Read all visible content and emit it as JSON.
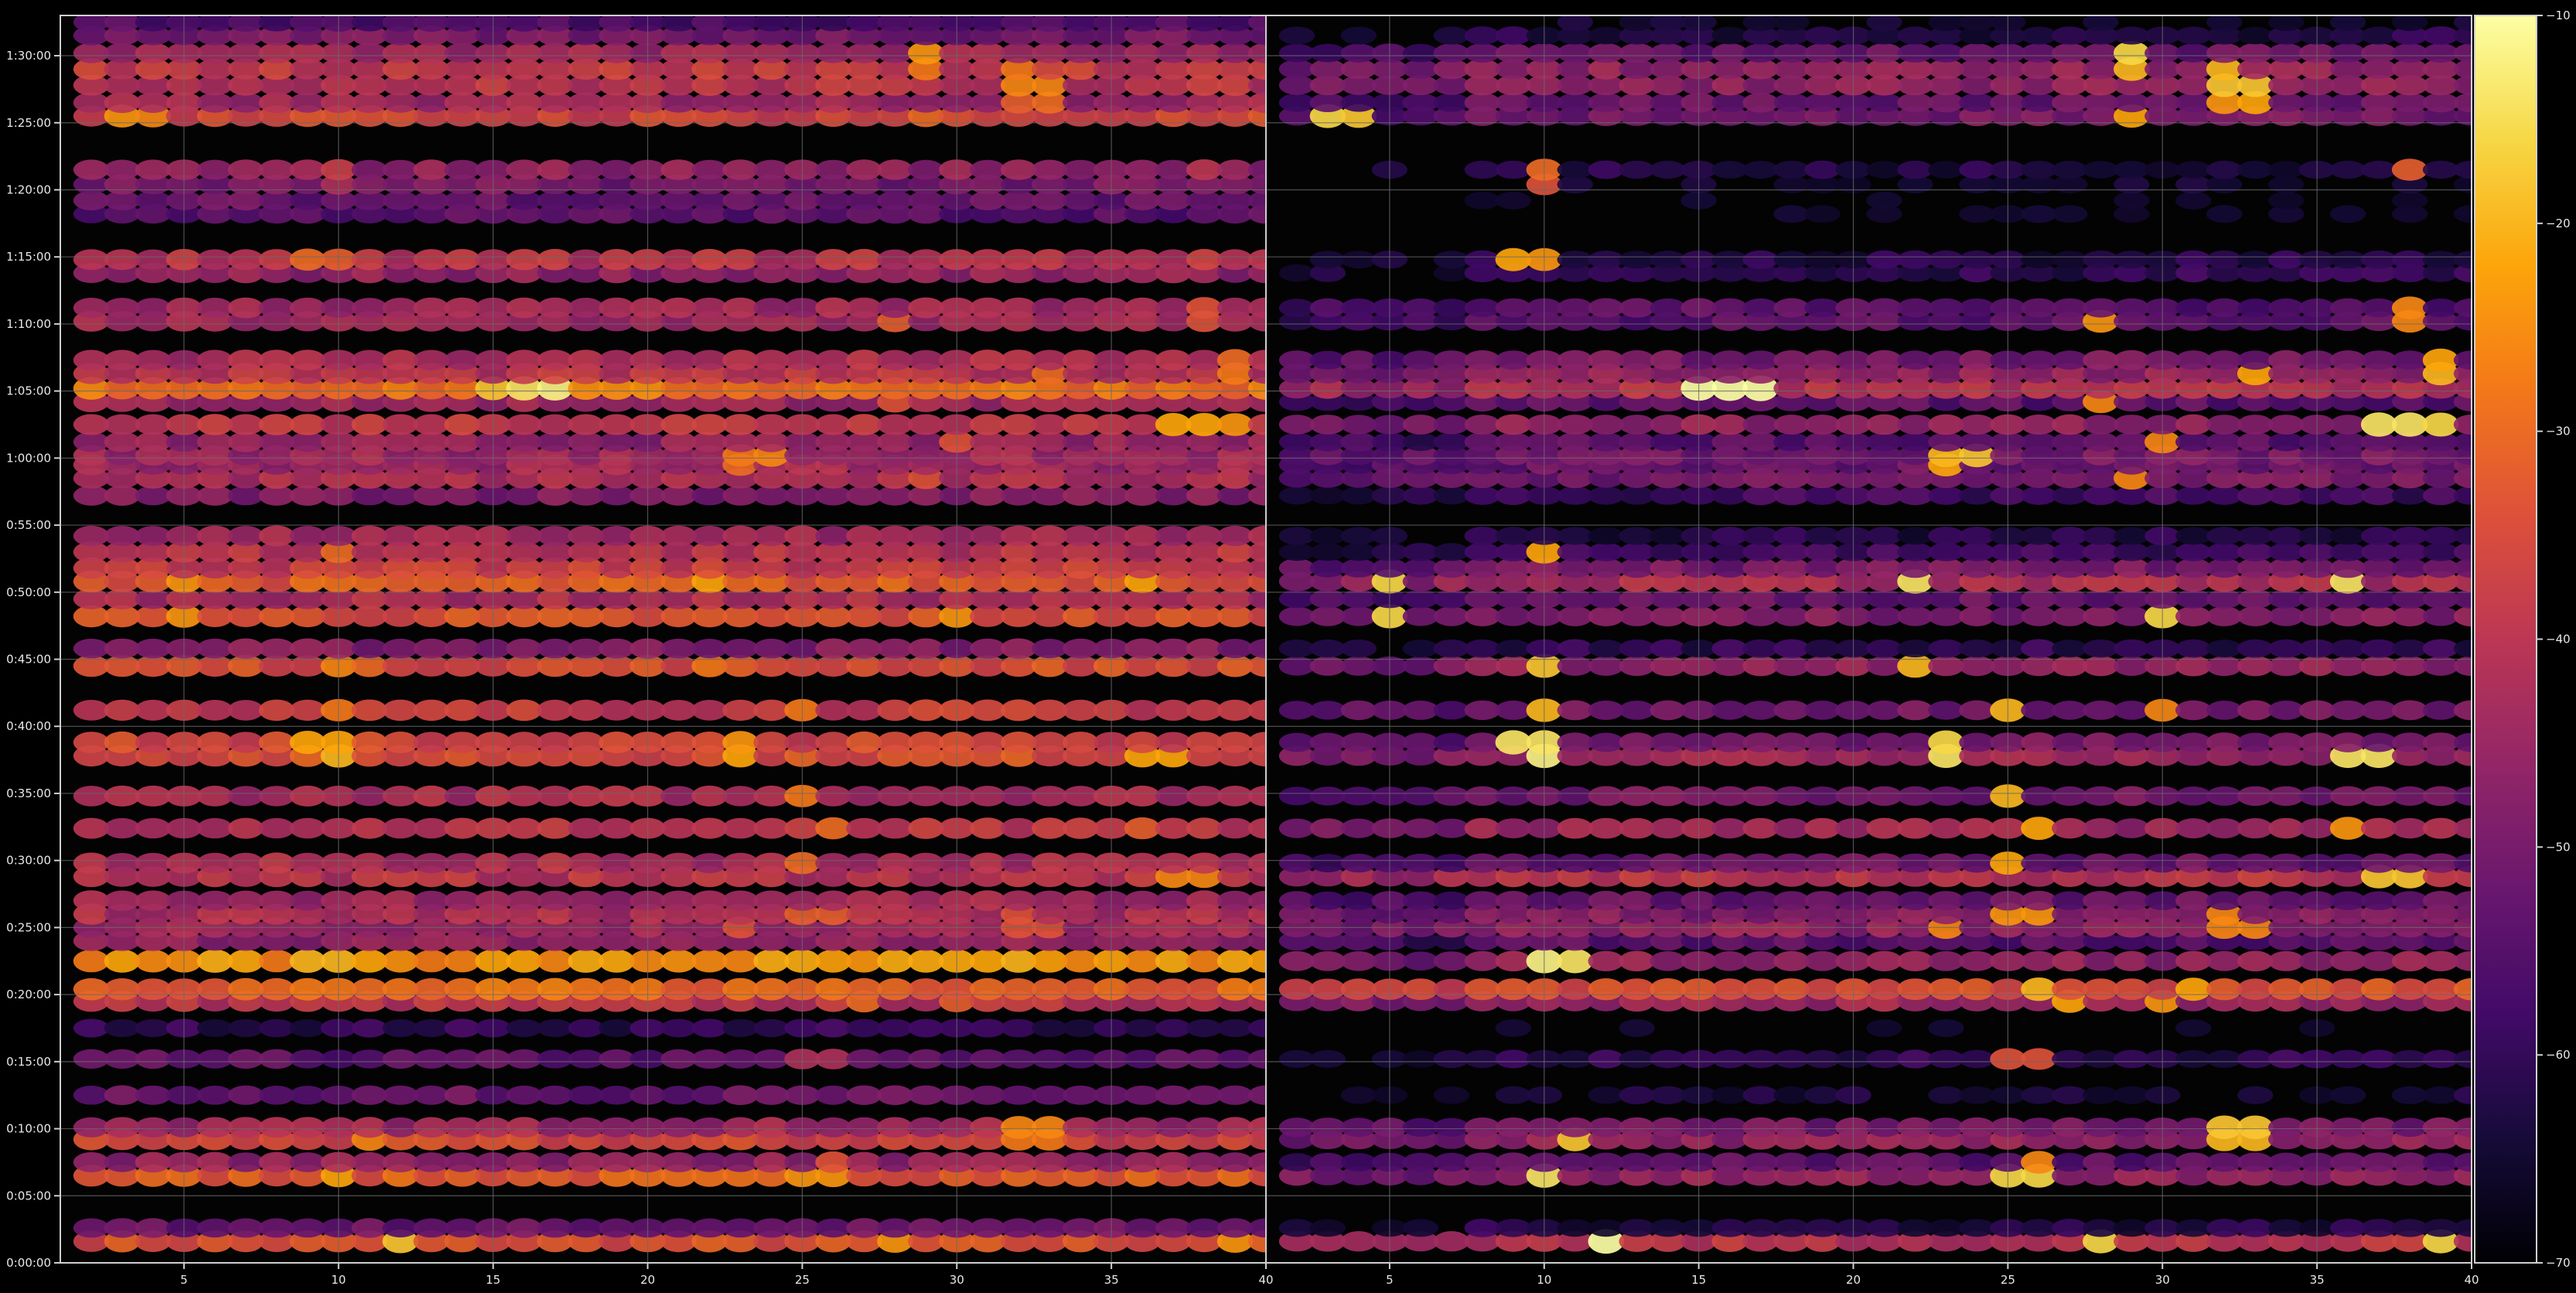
{
  "chart_data": {
    "type": "heatmap",
    "title": "",
    "xlabel": "",
    "ylabel": "",
    "panels": [
      {
        "name": "left",
        "xlim": [
          1,
          40
        ],
        "xticks": [
          5,
          10,
          15,
          20,
          25,
          30,
          35,
          40
        ],
        "x_columns": [
          2,
          40
        ]
      },
      {
        "name": "right",
        "xlim": [
          1,
          40
        ],
        "xticks": [
          5,
          10,
          15,
          20,
          25,
          30,
          35,
          40
        ],
        "x_columns": [
          2,
          40
        ]
      }
    ],
    "y_axis": {
      "unit": "minutes",
      "range_minutes": [
        0,
        93
      ],
      "ticks_minutes": [
        0,
        5,
        10,
        15,
        20,
        25,
        30,
        35,
        40,
        45,
        50,
        55,
        60,
        65,
        70,
        75,
        80,
        85,
        90
      ],
      "tick_labels": [
        "0:00:00",
        "0:05:00",
        "0:10:00",
        "0:15:00",
        "0:20:00",
        "0:25:00",
        "0:30:00",
        "0:35:00",
        "0:40:00",
        "0:45:00",
        "0:50:00",
        "0:55:00",
        "1:00:00",
        "1:05:00",
        "1:10:00",
        "1:15:00",
        "1:20:00",
        "1:25:00",
        "1:30:00"
      ]
    },
    "colorbar": {
      "colormap": "inferno",
      "range": [
        -70,
        -10
      ],
      "ticks": [
        -70,
        -60,
        -50,
        -40,
        -30,
        -20,
        -10
      ],
      "tick_labels": [
        "−70",
        "−60",
        "−50",
        "−40",
        "−30",
        "−20",
        "−10"
      ]
    },
    "grid": true,
    "background": "#000000",
    "bands": [
      {
        "t": 1.6,
        "left": -34,
        "right": -40,
        "peaks": [
          [
            12,
            -18
          ],
          [
            28,
            -24
          ],
          [
            39,
            -24
          ]
        ]
      },
      {
        "t": 2.6,
        "left": -52,
        "right": -62,
        "peaks": []
      },
      {
        "t": 6.5,
        "left": -32,
        "right": -46,
        "peaks": [
          [
            10,
            -22
          ],
          [
            25,
            -24
          ],
          [
            26,
            -24
          ]
        ]
      },
      {
        "t": 7.5,
        "left": -46,
        "right": -54,
        "peaks": [
          [
            26,
            -34
          ]
        ]
      },
      {
        "t": 9.2,
        "left": -36,
        "right": -46,
        "peaks": [
          [
            11,
            -26
          ],
          [
            32,
            -28
          ],
          [
            33,
            -28
          ]
        ]
      },
      {
        "t": 10.1,
        "left": -44,
        "right": -50,
        "peaks": [
          [
            32,
            -26
          ],
          [
            33,
            -26
          ]
        ]
      },
      {
        "t": 12.5,
        "left": -52,
        "right": -64,
        "peaks": []
      },
      {
        "t": 15.2,
        "left": -54,
        "right": -60,
        "peaks": [
          [
            25,
            -42
          ],
          [
            26,
            -42
          ]
        ]
      },
      {
        "t": 17.5,
        "left": -60,
        "right": -68,
        "peaks": []
      },
      {
        "t": 19.5,
        "left": -40,
        "right": -44,
        "peaks": [
          [
            27,
            -30
          ],
          [
            30,
            -32
          ]
        ]
      },
      {
        "t": 20.4,
        "left": -30,
        "right": -34,
        "peaks": [
          [
            26,
            -28
          ],
          [
            31,
            -30
          ]
        ]
      },
      {
        "t": 22.5,
        "left": -24,
        "right": -46,
        "peaks": [
          [
            10,
            -20
          ],
          [
            11,
            -22
          ]
        ]
      },
      {
        "t": 24.0,
        "left": -46,
        "right": -54,
        "peaks": []
      },
      {
        "t": 25.0,
        "left": -44,
        "right": -46,
        "peaks": [
          [
            23,
            -34
          ],
          [
            32,
            -34
          ],
          [
            33,
            -34
          ]
        ]
      },
      {
        "t": 26.0,
        "left": -42,
        "right": -48,
        "peaks": [
          [
            25,
            -32
          ],
          [
            26,
            -32
          ],
          [
            32,
            -34
          ]
        ]
      },
      {
        "t": 27.0,
        "left": -44,
        "right": -52,
        "peaks": []
      },
      {
        "t": 28.8,
        "left": -40,
        "right": -40,
        "peaks": [
          [
            37,
            -26
          ],
          [
            38,
            -26
          ]
        ]
      },
      {
        "t": 29.8,
        "left": -42,
        "right": -52,
        "peaks": [
          [
            25,
            -30
          ]
        ]
      },
      {
        "t": 32.4,
        "left": -40,
        "right": -44,
        "peaks": [
          [
            26,
            -30
          ],
          [
            36,
            -32
          ]
        ]
      },
      {
        "t": 34.8,
        "left": -42,
        "right": -50,
        "peaks": [
          [
            25,
            -28
          ]
        ]
      },
      {
        "t": 37.8,
        "left": -34,
        "right": -44,
        "peaks": [
          [
            10,
            -20
          ],
          [
            23,
            -22
          ],
          [
            36,
            -22
          ],
          [
            37,
            -22
          ]
        ]
      },
      {
        "t": 38.8,
        "left": -36,
        "right": -50,
        "peaks": [
          [
            9,
            -22
          ],
          [
            10,
            -22
          ],
          [
            23,
            -24
          ]
        ]
      },
      {
        "t": 41.2,
        "left": -38,
        "right": -50,
        "peaks": [
          [
            10,
            -28
          ],
          [
            25,
            -28
          ],
          [
            30,
            -34
          ]
        ]
      },
      {
        "t": 44.5,
        "left": -34,
        "right": -46,
        "peaks": [
          [
            10,
            -26
          ],
          [
            22,
            -28
          ]
        ]
      },
      {
        "t": 45.8,
        "left": -48,
        "right": -60,
        "peaks": []
      },
      {
        "t": 48.2,
        "left": -34,
        "right": -48,
        "peaks": [
          [
            5,
            -24
          ],
          [
            30,
            -24
          ]
        ]
      },
      {
        "t": 49.5,
        "left": -42,
        "right": -52,
        "peaks": []
      },
      {
        "t": 50.8,
        "left": -32,
        "right": -42,
        "peaks": [
          [
            5,
            -24
          ],
          [
            22,
            -22
          ],
          [
            36,
            -22
          ]
        ]
      },
      {
        "t": 51.8,
        "left": -38,
        "right": -50,
        "peaks": []
      },
      {
        "t": 53.0,
        "left": -40,
        "right": -58,
        "peaks": [
          [
            10,
            -30
          ]
        ]
      },
      {
        "t": 54.2,
        "left": -44,
        "right": -62,
        "peaks": []
      },
      {
        "t": 57.2,
        "left": -48,
        "right": -58,
        "peaks": []
      },
      {
        "t": 58.5,
        "left": -42,
        "right": -50,
        "peaks": [
          [
            29,
            -34
          ]
        ]
      },
      {
        "t": 59.5,
        "left": -44,
        "right": -52,
        "peaks": [
          [
            23,
            -30
          ]
        ]
      },
      {
        "t": 60.2,
        "left": -44,
        "right": -50,
        "peaks": [
          [
            23,
            -28
          ],
          [
            24,
            -26
          ]
        ]
      },
      {
        "t": 61.2,
        "left": -46,
        "right": -54,
        "peaks": [
          [
            30,
            -34
          ]
        ]
      },
      {
        "t": 62.5,
        "left": -38,
        "right": -46,
        "peaks": [
          [
            37,
            -22
          ],
          [
            38,
            -22
          ],
          [
            39,
            -24
          ]
        ]
      },
      {
        "t": 64.2,
        "left": -44,
        "right": -54,
        "peaks": [
          [
            28,
            -34
          ]
        ]
      },
      {
        "t": 65.2,
        "left": -28,
        "right": -40,
        "peaks": [
          [
            16,
            -14
          ],
          [
            17,
            -12
          ],
          [
            15,
            -18
          ]
        ]
      },
      {
        "t": 66.3,
        "left": -40,
        "right": -46,
        "peaks": [
          [
            33,
            -30
          ],
          [
            39,
            -28
          ]
        ]
      },
      {
        "t": 67.3,
        "left": -42,
        "right": -50,
        "peaks": [
          [
            39,
            -30
          ]
        ]
      },
      {
        "t": 70.2,
        "left": -44,
        "right": -54,
        "peaks": [
          [
            28,
            -32
          ],
          [
            38,
            -34
          ]
        ]
      },
      {
        "t": 71.2,
        "left": -44,
        "right": -54,
        "peaks": [
          [
            38,
            -34
          ]
        ]
      },
      {
        "t": 73.8,
        "left": -46,
        "right": -60,
        "peaks": []
      },
      {
        "t": 74.8,
        "left": -40,
        "right": -62,
        "peaks": [
          [
            9,
            -30
          ],
          [
            10,
            -32
          ]
        ]
      },
      {
        "t": 78.2,
        "left": -54,
        "right": -68,
        "peaks": []
      },
      {
        "t": 79.2,
        "left": -52,
        "right": -68,
        "peaks": []
      },
      {
        "t": 80.4,
        "left": -50,
        "right": -66,
        "peaks": [
          [
            10,
            -42
          ]
        ]
      },
      {
        "t": 81.5,
        "left": -46,
        "right": -62,
        "peaks": [
          [
            10,
            -38
          ],
          [
            38,
            -40
          ]
        ]
      },
      {
        "t": 85.5,
        "left": -36,
        "right": -50,
        "peaks": [
          [
            3,
            -24
          ],
          [
            4,
            -26
          ],
          [
            29,
            -30
          ]
        ]
      },
      {
        "t": 86.5,
        "left": -44,
        "right": -52,
        "peaks": [
          [
            32,
            -32
          ],
          [
            33,
            -30
          ]
        ]
      },
      {
        "t": 87.8,
        "left": -40,
        "right": -46,
        "peaks": [
          [
            32,
            -26
          ],
          [
            33,
            -26
          ]
        ]
      },
      {
        "t": 89.0,
        "left": -38,
        "right": -46,
        "peaks": [
          [
            29,
            -28
          ],
          [
            32,
            -28
          ]
        ]
      },
      {
        "t": 90.2,
        "left": -44,
        "right": -52,
        "peaks": [
          [
            29,
            -24
          ]
        ]
      },
      {
        "t": 91.5,
        "left": -50,
        "right": -62,
        "peaks": []
      },
      {
        "t": 92.5,
        "left": -56,
        "right": -66,
        "peaks": []
      }
    ]
  }
}
